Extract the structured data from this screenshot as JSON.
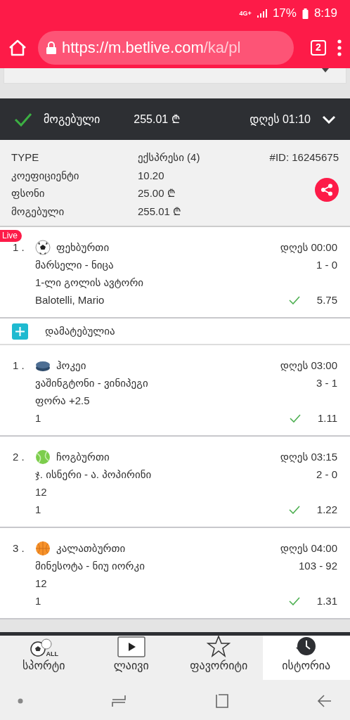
{
  "status_bar": {
    "network": "4G+",
    "battery": "17%",
    "time": "8:19"
  },
  "browser": {
    "url_host": "https://m.betlive.com",
    "url_path": "/ka/pl",
    "tab_count": "2"
  },
  "bet_header": {
    "won": true,
    "status": "მოგებული",
    "amount": "255.01 ₾",
    "time": "დღეს 01:10",
    "expanded": true
  },
  "details": {
    "rows": [
      {
        "label": "TYPE",
        "value": "ექსპრესი (4)"
      },
      {
        "label": "კოეფიციენტი",
        "value": "10.20"
      },
      {
        "label": "ფსონი",
        "value": "25.00 ₾"
      },
      {
        "label": "მოგებული",
        "value": "255.01 ₾"
      }
    ],
    "bet_id": "#ID: 16245675"
  },
  "events": [
    {
      "kind": "event",
      "live": true,
      "live_label": "Live",
      "number": "1 .",
      "sport_name": "ფეხბურთი",
      "time": "დღეს 00:00",
      "teams": "მარსელი - ნიცა",
      "score": "1 - 0",
      "market": "1-ლი გოლის ავტორი",
      "pick": "Balotelli, Mario",
      "won": true,
      "odds": "5.75"
    },
    {
      "kind": "added",
      "label": "დამატებულია"
    },
    {
      "kind": "event",
      "number": "1 .",
      "sport_name": "ჰოკეი",
      "time": "დღეს 03:00",
      "teams": "ვაშინგტონი - ვინიპეგი",
      "score": "3 - 1",
      "market": "ფორა +2.5",
      "pick": "1",
      "won": true,
      "odds": "1.11"
    },
    {
      "kind": "event",
      "number": "2 .",
      "sport_name": "ჩოგბურთი",
      "time": "დღეს 03:15",
      "teams": "ჯ. ისნერი - ა. პოპირინი",
      "score": "2 - 0",
      "market": "12",
      "pick": "1",
      "won": true,
      "odds": "1.22"
    },
    {
      "kind": "event",
      "number": "3 .",
      "sport_name": "კალათბურთი",
      "time": "დღეს 04:00",
      "teams": "მინესოტა - ნიუ იორკი",
      "score": "103 - 92",
      "market": "12",
      "pick": "1",
      "won": true,
      "odds": "1.31"
    }
  ],
  "bottom_nav": [
    {
      "badge": "ALL",
      "label": "სპორტი",
      "selected": false
    },
    {
      "label": "ლაივი",
      "selected": false
    },
    {
      "label": "ფავორიტი",
      "selected": false
    },
    {
      "label": "ისტორია",
      "selected": true
    }
  ]
}
